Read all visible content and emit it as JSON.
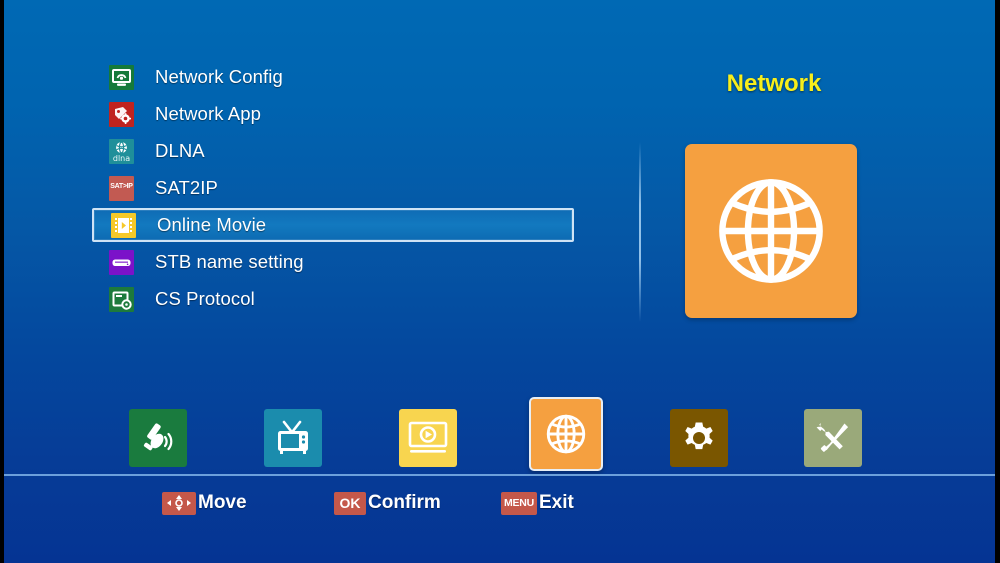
{
  "screen": {
    "background_top": "#0069b4",
    "background_bottom": "#053493"
  },
  "menu": {
    "items": [
      {
        "label": "Network Config",
        "icon": "network-config-icon",
        "icon_color": "#157a3a",
        "selected": false
      },
      {
        "label": "Network App",
        "icon": "network-app-icon",
        "icon_color": "#c0231f",
        "selected": false
      },
      {
        "label": "DLNA",
        "icon": "dlna-icon",
        "icon_color": "#1f8f9a",
        "selected": false,
        "icon_text": "dlna"
      },
      {
        "label": "SAT2IP",
        "icon": "sat2ip-icon",
        "icon_color": "#c25a52",
        "selected": false,
        "icon_text": "SAT>IP"
      },
      {
        "label": "Online Movie",
        "icon": "online-movie-icon",
        "icon_color": "#f6c928",
        "selected": true
      },
      {
        "label": "STB name setting",
        "icon": "stb-icon",
        "icon_color": "#7b12c9",
        "selected": false
      },
      {
        "label": "CS Protocol",
        "icon": "cs-protocol-icon",
        "icon_color": "#1d7a3c",
        "selected": false
      }
    ]
  },
  "panel": {
    "title": "Network",
    "title_color": "#f7ee1b",
    "tile_icon": "globe-icon",
    "tile_color": "#f5a040"
  },
  "icon_bar": {
    "items": [
      {
        "name": "satellite",
        "icon": "satellite-dish-icon",
        "color": "#1a7b3e",
        "active": false
      },
      {
        "name": "tv",
        "icon": "television-icon",
        "color": "#1b8cad",
        "active": false
      },
      {
        "name": "media",
        "icon": "media-player-icon",
        "color": "#f8d54f",
        "active": false
      },
      {
        "name": "network",
        "icon": "globe-icon",
        "color": "#f5a040",
        "active": true
      },
      {
        "name": "settings",
        "icon": "gear-icon",
        "color": "#7a5600",
        "active": false
      },
      {
        "name": "tools",
        "icon": "tools-icon",
        "color": "#9aa97a",
        "active": false
      }
    ]
  },
  "help_bar": {
    "items": [
      {
        "key": "",
        "key_icon": "dpad-arrows-icon",
        "label": "Move"
      },
      {
        "key": "OK",
        "label": "Confirm"
      },
      {
        "key": "MENU",
        "label": "Exit"
      }
    ],
    "key_badge_color": "#c4584a"
  }
}
